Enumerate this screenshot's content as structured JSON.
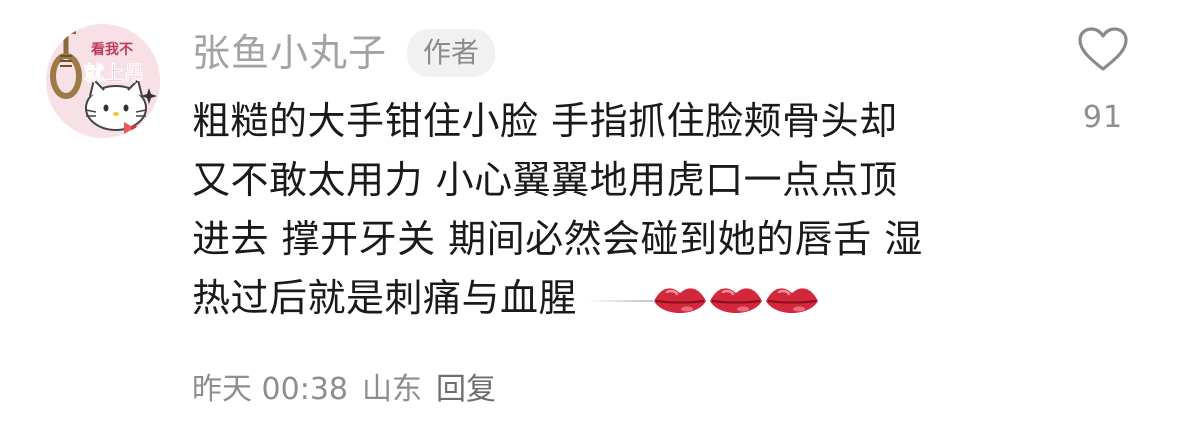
{
  "comment": {
    "username": "张鱼小丸子",
    "author_badge": "作者",
    "avatar_text": [
      "看我不",
      "就上吊"
    ],
    "body_lines": [
      "粗糙的大手钳住小脸 手指抓住脸颊骨头却",
      "又不敢太用力 小心翼翼地用虎口一点点顶",
      "进去 撑开牙关 期间必然会碰到她的唇舌 湿",
      "热过后就是刺痛与血腥"
    ],
    "emoji_icons": [
      "kiss-lips-icon",
      "kiss-lips-icon",
      "kiss-lips-icon"
    ],
    "time": "昨天 00:38",
    "location": "山东",
    "reply_label": "回复",
    "like_count": "91"
  },
  "colors": {
    "username": "#a3a3a3",
    "text": "#1a1a1a",
    "meta": "#8e8e8e",
    "badge_bg": "#f1f1f1",
    "lips": "#d3283c"
  }
}
